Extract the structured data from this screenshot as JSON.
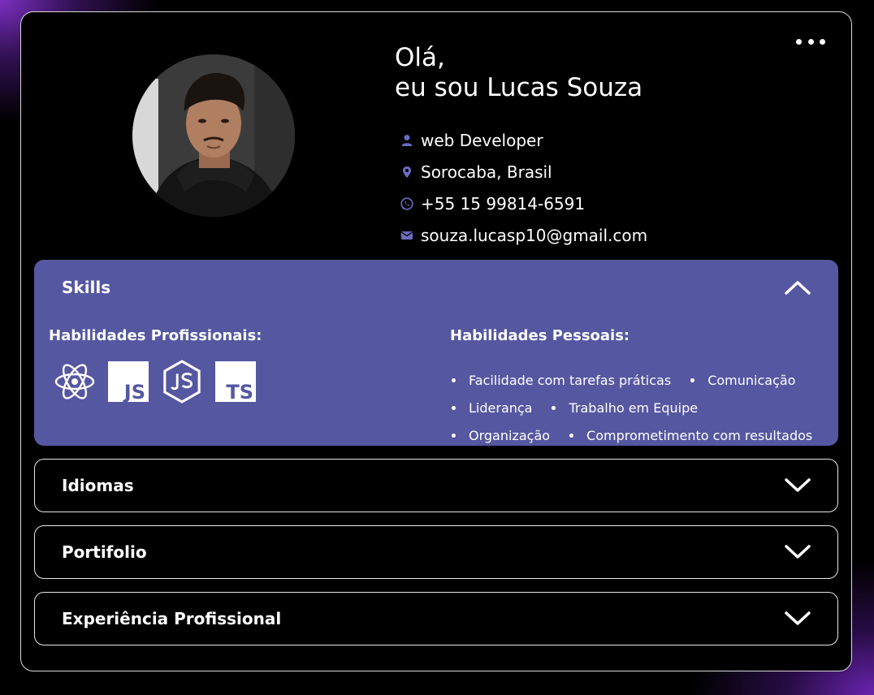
{
  "profile": {
    "greeting_line1": "Olá,",
    "greeting_line2": "eu sou Lucas Souza",
    "info": [
      {
        "icon": "person-icon",
        "text": "web Developer"
      },
      {
        "icon": "location-pin-icon",
        "text": "Sorocaba, Brasil"
      },
      {
        "icon": "whatsapp-icon",
        "text": "+55 15 99814-6591"
      },
      {
        "icon": "mail-icon",
        "text": "souza.lucasp10@gmail.com"
      }
    ]
  },
  "menu": {
    "icon": "more-horizontal-icon"
  },
  "sections": {
    "skills": {
      "title": "Skills",
      "expanded": true,
      "professional_title": "Habilidades Profissionais:",
      "professional_logos": [
        "react-logo-icon",
        "javascript-logo-icon",
        "nodejs-logo-icon",
        "typescript-logo-icon"
      ],
      "js_label": "JS",
      "ts_label": "TS",
      "personal_title": "Habilidades Pessoais:",
      "personal_items": [
        "Facilidade com tarefas práticas",
        "Comunicação",
        "Liderança",
        "Trabalho em Equipe",
        "Organização",
        "Comprometimento com resultados"
      ]
    },
    "idiomas": {
      "title": "Idiomas",
      "expanded": false
    },
    "portfolio": {
      "title": "Portifolio",
      "expanded": false
    },
    "experiencia": {
      "title": "Experiência Profissional",
      "expanded": false
    }
  },
  "colors": {
    "accent": "#5557a1",
    "background": "#000000",
    "text": "#ffffff",
    "glow": "#7b2fc0"
  }
}
